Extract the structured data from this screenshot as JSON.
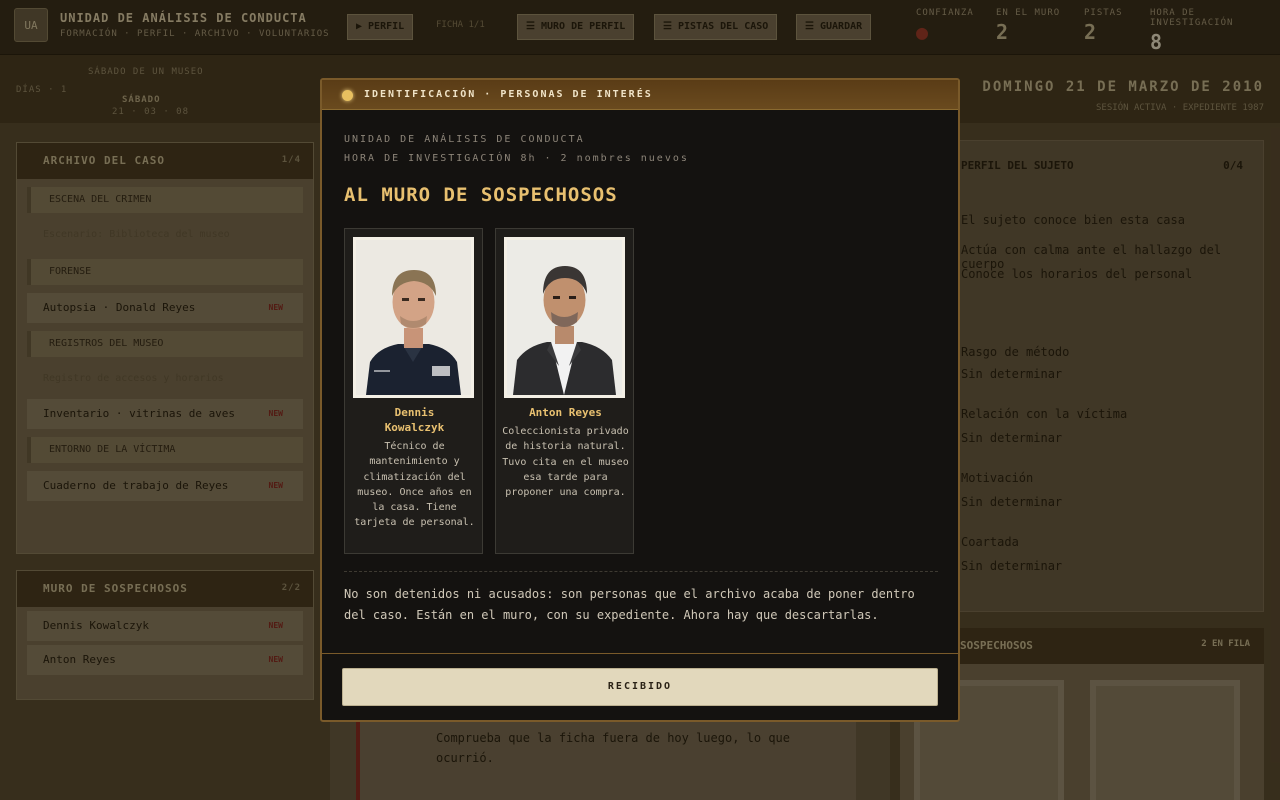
{
  "app": {
    "title": "UNIDAD DE ANÁLISIS DE CONDUCTA",
    "subtitle": "FORMACIÓN · PERFIL · ARCHIVO · VOLUNTARIOS",
    "logo_text": "UA",
    "toolbar": {
      "btn1": "▶ PERFIL",
      "note": "FICHA 1/1",
      "btn2": "☰ MURO DE PERFIL",
      "btn3": "☰ PISTAS DEL CASO",
      "btn4": "☰ GUARDAR"
    },
    "stats": [
      {
        "label": "CONFIANZA",
        "value": "●"
      },
      {
        "label": "EN EL MURO",
        "value": "2"
      },
      {
        "label": "PISTAS",
        "value": "2"
      },
      {
        "label": "HORA DE INVESTIGACIÓN",
        "value": "8"
      }
    ],
    "subbar": {
      "left_label": "DÍAS · 1",
      "day_label": "SÁBADO DE UN MUSEO",
      "center_label": "SÁBADO",
      "center_sub": "21 · 03 · 08",
      "date": "DOMINGO 21 DE MARZO DE 2010",
      "date_sub": "SESIÓN ACTIVA · EXPEDIENTE 1987"
    }
  },
  "left_panel": {
    "header": "ARCHIVO DEL CASO",
    "count": "1/4",
    "sections": [
      {
        "title": "ESCENA DEL CRIMEN",
        "rows": [
          {
            "text": "Escenario: Biblioteca del museo",
            "tag": "",
            "faint": true
          }
        ]
      },
      {
        "title": "FORENSE",
        "rows": [
          {
            "text": "Autopsia · Donald Reyes",
            "tag": "NEW",
            "faint": false
          }
        ]
      },
      {
        "title": "REGISTROS DEL MUSEO",
        "rows": [
          {
            "text": "Registro de accesos y horarios",
            "tag": "",
            "faint": true
          },
          {
            "text": "Inventario · vitrinas de aves",
            "tag": "NEW",
            "faint": false
          }
        ]
      },
      {
        "title": "ENTORNO DE LA VÍCTIMA",
        "rows": [
          {
            "text": "Cuaderno de trabajo de Reyes",
            "tag": "NEW",
            "faint": false
          }
        ]
      }
    ]
  },
  "left_panel2": {
    "header": "MURO DE SOSPECHOSOS",
    "count": "2/2",
    "rows": [
      {
        "text": "Dennis Kowalczyk",
        "tag": "NEW"
      },
      {
        "text": "Anton Reyes",
        "tag": "NEW"
      }
    ]
  },
  "right_panel": {
    "header": "PERFIL DEL SUJETO",
    "count": "0/4",
    "lines": [
      "El sujeto conoce bien esta casa",
      "Actúa con calma ante el hallazgo del cuerpo",
      "Conoce los horarios del personal",
      "Rasgo de método",
      "Sin determinar",
      "Relación con la víctima",
      "Sin determinar",
      "Motivación",
      "Sin determinar",
      "Coartada",
      "Sin determinar"
    ]
  },
  "right_panel2": {
    "header": "SOSPECHOSOS",
    "count": "2 EN FILA"
  },
  "center_bg": {
    "text": "Comprueba que la ficha fuera de hoy luego, lo que ocurrió."
  },
  "modal": {
    "header": "IDENTIFICACIÓN · PERSONAS DE INTERÉS",
    "kicker1": "UNIDAD DE ANÁLISIS DE CONDUCTA",
    "kicker2": "HORA DE INVESTIGACIÓN 8h · 2 nombres nuevos",
    "heading": "AL MURO DE SOSPECHOSOS",
    "suspects": [
      {
        "name": "Dennis Kowalczyk",
        "name_l1": "Dennis",
        "name_l2": "Kowalczyk",
        "desc": "Técnico de mantenimiento y climatización del museo. Once años en la casa. Tiene tarjeta de personal.",
        "photo_icon": "portrait-photo-dennis"
      },
      {
        "name": "Anton Reyes",
        "desc": "Coleccionista privado de historia natural. Tuvo cita en el museo esa tarde para proponer una compra.",
        "photo_icon": "portrait-photo-anton"
      }
    ],
    "body": "No son detenidos ni acusados: son personas que el archivo acaba de poner dentro del caso. Están en el muro, con su expediente. Ahora hay que descartarlas.",
    "button": "RECIBIDO"
  }
}
